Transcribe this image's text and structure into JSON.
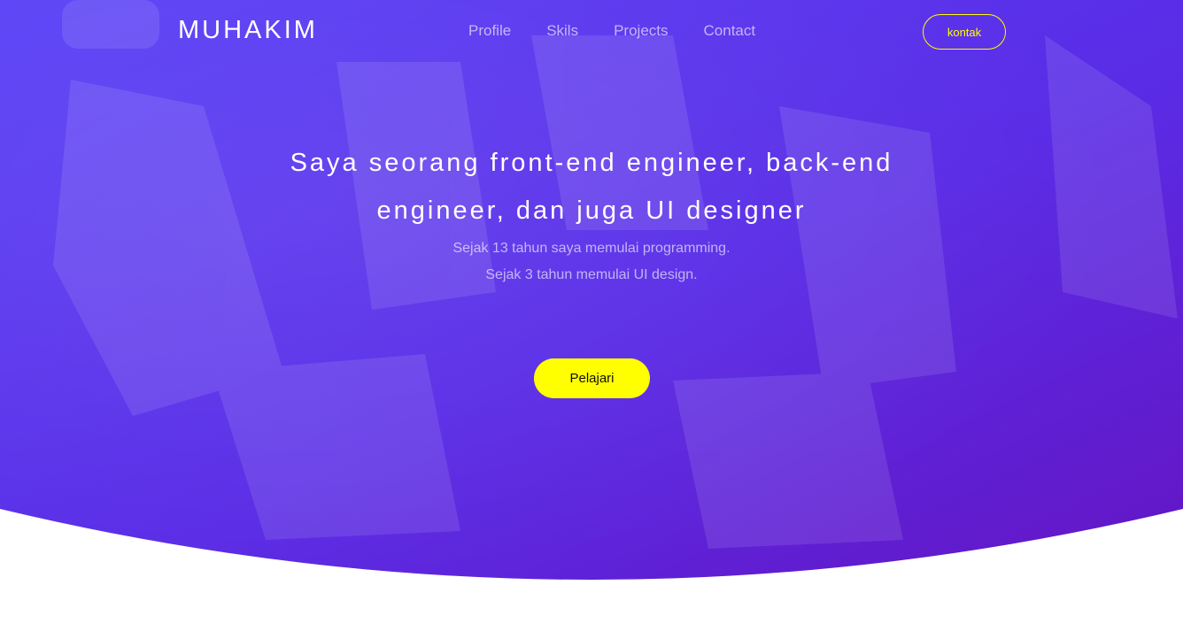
{
  "brand": {
    "logo_text": "MUHAKIM"
  },
  "nav": {
    "items": [
      {
        "label": "Profile"
      },
      {
        "label": "Skils"
      },
      {
        "label": "Projects"
      },
      {
        "label": "Contact"
      }
    ],
    "contact_button": "kontak"
  },
  "hero": {
    "headline": "Saya seorang front-end engineer, back-end engineer, dan juga UI designer",
    "subtext": [
      "Sejak 13 tahun saya memulai programming.",
      "Sejak 3 tahun memulai UI design."
    ],
    "cta_label": "Pelajari"
  },
  "colors": {
    "gradient_start": "#5a40f6",
    "gradient_end": "#6418c8",
    "accent": "#ffff00",
    "page_bg": "#ffffff"
  }
}
